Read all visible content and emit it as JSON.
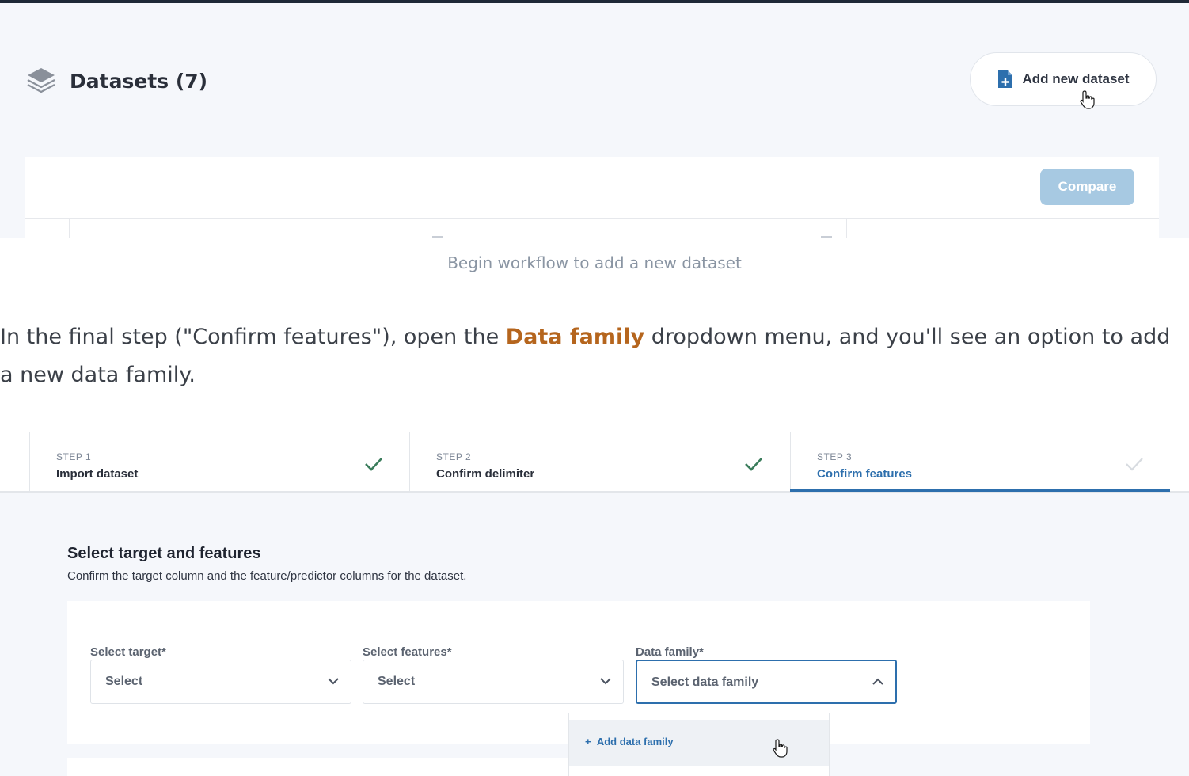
{
  "datasets_page": {
    "title": "Datasets (7)",
    "add_button_label": "Add new dataset",
    "compare_button_label": "Compare"
  },
  "caption": "Begin workflow to add a new dataset",
  "instruction": {
    "before": "In the final step (\"Confirm features\"), open the ",
    "highlight": "Data family",
    "after": " dropdown menu, and you'll see an option to add a new data family."
  },
  "wizard": {
    "steps": [
      {
        "number": "STEP 1",
        "name": "Import dataset",
        "status": "complete"
      },
      {
        "number": "STEP 2",
        "name": "Confirm delimiter",
        "status": "complete"
      },
      {
        "number": "STEP 3",
        "name": "Confirm features",
        "status": "active"
      }
    ],
    "section_title": "Select target and features",
    "section_subtitle": "Confirm the target column and the feature/predictor columns for the dataset.",
    "fields": [
      {
        "label": "Select target*",
        "value": "Select"
      },
      {
        "label": "Select features*",
        "value": "Select"
      },
      {
        "label": "Data family*",
        "value": "Select data family"
      }
    ],
    "dropdown_option": "Add data family"
  },
  "colors": {
    "accent_blue": "#2d6fad",
    "highlight_orange": "#b5651d",
    "check_green": "#3b7d5c"
  }
}
